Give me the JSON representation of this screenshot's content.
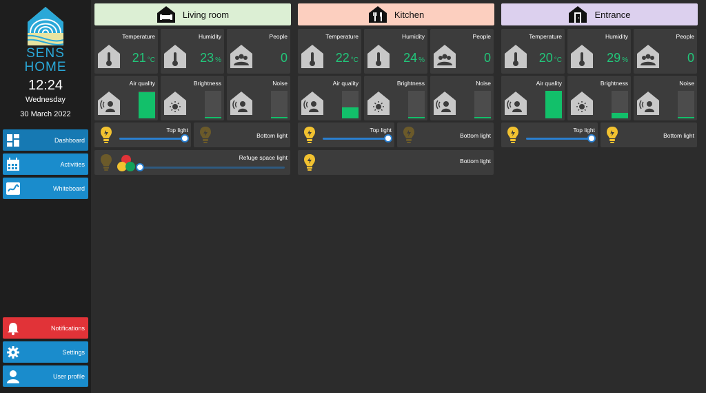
{
  "brand": {
    "line1": "SENS",
    "line2": "HOME"
  },
  "clock": {
    "time": "12:24",
    "day": "Wednesday",
    "date": "30 March 2022"
  },
  "nav": {
    "dashboard": "Dashboard",
    "activities": "Activities",
    "whiteboard": "Whiteboard",
    "notifications": "Notifications",
    "settings": "Settings",
    "user_profile": "User profile"
  },
  "colors": {
    "sidebar_blue": "#1a8ccc",
    "notification_red": "#e13338",
    "value_green": "#22c67a",
    "bulb_on": "#f2c230",
    "bulb_off": "#6b5a2a",
    "living_header": "#dcefd4",
    "kitchen_header": "#fccfbf",
    "entrance_header": "#dcd0ee"
  },
  "labels": {
    "temperature": "Temperature",
    "humidity": "Humidity",
    "people": "People",
    "air_quality": "Air quality",
    "brightness": "Brightness",
    "noise": "Noise",
    "top_light": "Top light",
    "bottom_light": "Bottom light",
    "refuge_light": "Refuge space light"
  },
  "rooms": {
    "living": {
      "name": "Living room",
      "icon": "sofa-house-icon",
      "temperature": "21",
      "temp_unit": "°C",
      "humidity": "23",
      "hum_unit": "%",
      "people": "0",
      "air_quality_level": 0.95,
      "brightness_level": 0.0,
      "noise_level": 0.0,
      "top_light": {
        "on": true,
        "level": 1.0
      },
      "bottom_light": {
        "on": false
      },
      "refuge_light": {
        "on": false,
        "level": 0.0
      }
    },
    "kitchen": {
      "name": "Kitchen",
      "icon": "cutlery-house-icon",
      "temperature": "22",
      "temp_unit": "°C",
      "humidity": "24",
      "hum_unit": "%",
      "people": "0",
      "air_quality_level": 0.4,
      "brightness_level": 0.0,
      "noise_level": 0.03,
      "top_light": {
        "on": true,
        "level": 1.0
      },
      "bottom_light": {
        "on": false
      },
      "extra_bottom_light": {
        "on": true
      }
    },
    "entrance": {
      "name": "Entrance",
      "icon": "door-house-icon",
      "temperature": "20",
      "temp_unit": "°C",
      "humidity": "29",
      "hum_unit": "%",
      "people": "0",
      "air_quality_level": 1.0,
      "brightness_level": 0.2,
      "noise_level": 0.0,
      "top_light": {
        "on": true,
        "level": 1.0
      },
      "bottom_light": {
        "on": true
      }
    }
  }
}
